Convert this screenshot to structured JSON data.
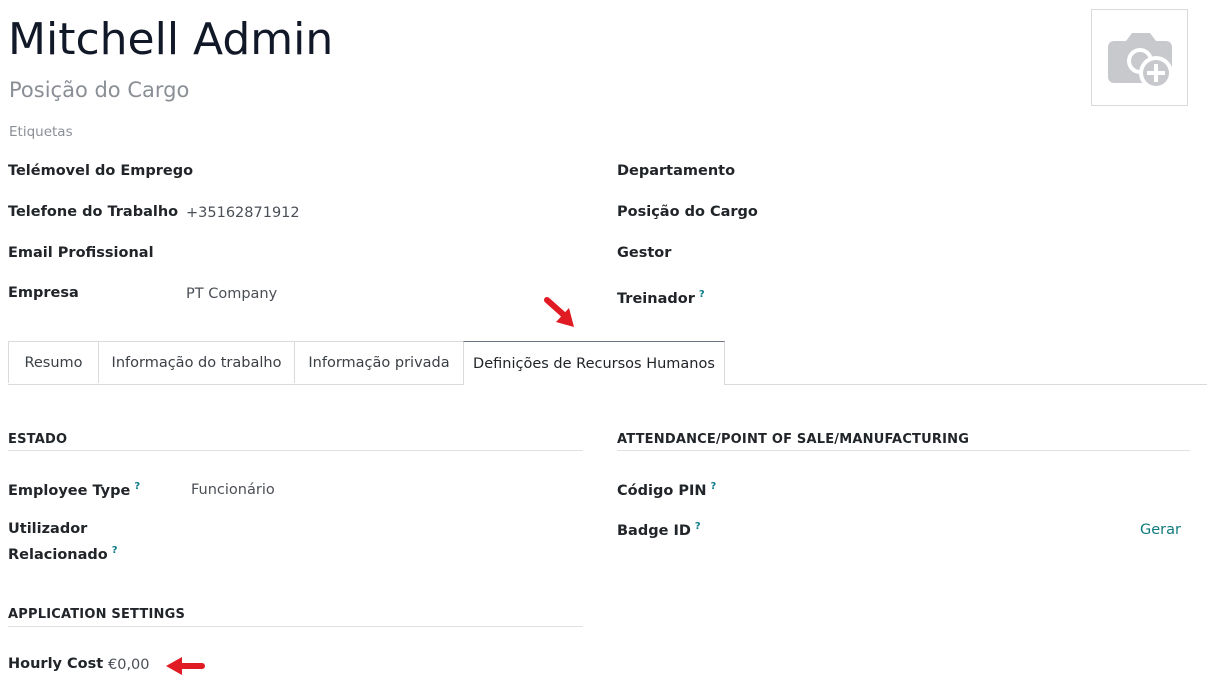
{
  "employee": {
    "name": "Mitchell Admin",
    "job_position_placeholder": "Posição do Cargo",
    "tags_placeholder": "Etiquetas"
  },
  "avatar": {
    "icon": "camera-plus-icon"
  },
  "fields_left": [
    {
      "label": "Telémovel do Emprego",
      "value": ""
    },
    {
      "label": "Telefone do Trabalho",
      "value": "+35162871912"
    },
    {
      "label": "Email Profissional",
      "value": ""
    },
    {
      "label": "Empresa",
      "value": "PT Company"
    }
  ],
  "fields_right": [
    {
      "label": "Departamento",
      "value": ""
    },
    {
      "label": "Posição do Cargo",
      "value": ""
    },
    {
      "label": "Gestor",
      "value": ""
    },
    {
      "label": "Treinador",
      "value": "",
      "help": "?"
    }
  ],
  "tabs": [
    {
      "label": "Resumo"
    },
    {
      "label": "Informação do trabalho"
    },
    {
      "label": "Informação privada"
    },
    {
      "label": "Definições de Recursos Humanos"
    }
  ],
  "estado": {
    "title": "ESTADO",
    "employee_type_label": "Employee Type",
    "employee_type_value": "Funcionário",
    "related_user_label_1": "Utilizador",
    "related_user_label_2": "Relacionado",
    "help": "?"
  },
  "attendance": {
    "title": "ATTENDANCE/POINT OF SALE/MANUFACTURING",
    "pin_label": "Código PIN",
    "badge_label": "Badge ID",
    "generate_label": "Gerar",
    "help": "?"
  },
  "app_settings": {
    "title": "APPLICATION SETTINGS",
    "hourly_cost_label": "Hourly Cost",
    "hourly_cost_value": "€0,00"
  },
  "colors": {
    "accent": "#117a7d",
    "arrow": "#e01b24"
  }
}
